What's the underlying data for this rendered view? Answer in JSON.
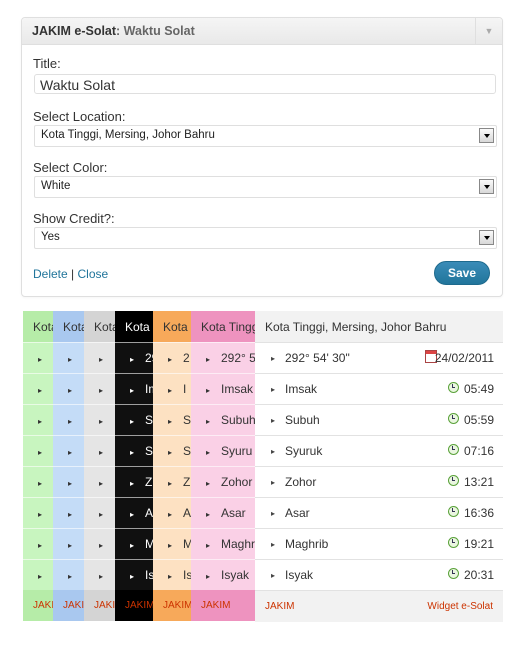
{
  "widget": {
    "title": "JAKIM e-Solat",
    "subtitle": ": Waktu Solat",
    "toggle_icon": "triangle-down",
    "title_label": "Title:",
    "title_value": "Waktu Solat",
    "location_label": "Select Location:",
    "location_value": "Kota Tinggi, Mersing, Johor Bahru",
    "color_label": "Select Color:",
    "color_value": "White",
    "credit_label": "Show Credit?:",
    "credit_value": "Yes",
    "delete_label": "Delete",
    "separator": "|",
    "close_label": "Close",
    "save_label": "Save"
  },
  "strips": [
    {
      "bg": "#c8f5bf",
      "hdr": "#b6eca8",
      "ftr": "#b6eca8",
      "fg": "#333",
      "ftr_fg": "#cc3300",
      "header": "Kota",
      "rows": [
        "",
        "",
        "",
        "",
        "",
        "",
        "",
        ""
      ],
      "footer": "JAKIM"
    },
    {
      "bg": "#c4dcf7",
      "hdr": "#a9c8ef",
      "ftr": "#a9c8ef",
      "fg": "#333",
      "ftr_fg": "#cc3300",
      "header": "Kota",
      "rows": [
        "",
        "",
        "",
        "",
        "",
        "",
        "",
        ""
      ],
      "footer": "JAKIM"
    },
    {
      "bg": "#e5e5e5",
      "hdr": "#d4d4d4",
      "ftr": "#d4d4d4",
      "fg": "#333",
      "ftr_fg": "#cc3300",
      "header": "Kota",
      "rows": [
        "",
        "",
        "",
        "",
        "",
        "",
        "",
        ""
      ],
      "footer": "JAKIM"
    },
    {
      "bg": "#101010",
      "hdr": "#000000",
      "ftr": "#000000",
      "fg": "#ffffff",
      "ftr_fg": "#cc3300",
      "header": "Kota",
      "rows": [
        "29",
        "Im",
        "S",
        "S",
        "Z",
        "A",
        "M",
        "Is"
      ],
      "footer": "JAKIM"
    },
    {
      "bg": "#fde1c2",
      "hdr": "#f7a95a",
      "ftr": "#f7a95a",
      "fg": "#333",
      "ftr_fg": "#cc3300",
      "header": "Kota",
      "rows": [
        "2",
        "I",
        "S",
        "S",
        "Z",
        "A",
        "M",
        "Is"
      ],
      "footer": "JAKIM"
    },
    {
      "bg": "#fad0e6",
      "hdr": "#ee93bf",
      "ftr": "#ee93bf",
      "fg": "#333",
      "ftr_fg": "#cc3300",
      "header": "Kota Tinggi",
      "rows": [
        "292° 5",
        "Imsak",
        "Subuh",
        "Syuru",
        "Zohor",
        "Asar",
        "Maghri",
        "Isyak"
      ],
      "footer": "JAKIM"
    }
  ],
  "main": {
    "header": "Kota Tinggi, Mersing, Johor Bahru",
    "qibla": "292° 54' 30\"",
    "date": "24/02/2011",
    "prayers": [
      {
        "name": "Imsak",
        "time": "05:49"
      },
      {
        "name": "Subuh",
        "time": "05:59"
      },
      {
        "name": "Syuruk",
        "time": "07:16"
      },
      {
        "name": "Zohor",
        "time": "13:21"
      },
      {
        "name": "Asar",
        "time": "16:36"
      },
      {
        "name": "Maghrib",
        "time": "19:21"
      },
      {
        "name": "Isyak",
        "time": "20:31"
      }
    ],
    "footer_left": "JAKIM",
    "footer_right": "Widget e-Solat"
  }
}
